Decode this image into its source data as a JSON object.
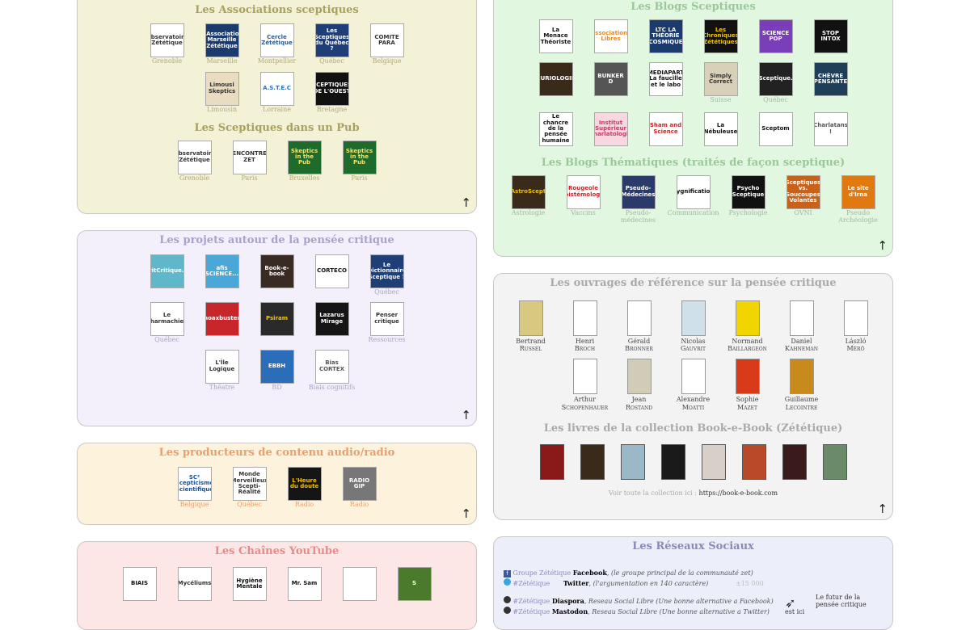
{
  "assoc": {
    "title": "Les Associations sceptiques",
    "items": [
      {
        "logo": "Observatoire Zététique",
        "caption": "Grenoble",
        "bg": "#ffffff",
        "fg": "#333"
      },
      {
        "logo": "L'Association Marseille Zététique",
        "caption": "Marseille",
        "bg": "#1b3b6f",
        "fg": "#fff"
      },
      {
        "logo": "Cercle Zététique",
        "caption": "Montpellier",
        "bg": "#ffffff",
        "fg": "#2a5a9a"
      },
      {
        "logo": "Les Sceptiques du Québec ?",
        "caption": "Québec",
        "bg": "#1f3e78",
        "fg": "#fff"
      },
      {
        "logo": "COMITE PARA",
        "caption": "Belgique",
        "bg": "#ffffff",
        "fg": "#333"
      },
      {
        "logo": "Limousi Skeptics",
        "caption": "Limousin",
        "bg": "#e9dcc0",
        "fg": "#333"
      },
      {
        "logo": "A.S.T.E.C",
        "caption": "Lorraine",
        "bg": "#ffffff",
        "fg": "#2a72b8"
      },
      {
        "logo": "SCEPTIQUES DE L'OUEST",
        "caption": "Bretagne",
        "bg": "#111111",
        "fg": "#fff"
      }
    ],
    "pub_title": "Les Sceptiques dans un Pub",
    "pub_items": [
      {
        "logo": "Observatoire Zététique",
        "caption": "Grenoble",
        "bg": "#ffffff",
        "fg": "#333"
      },
      {
        "logo": "RENCONTRES ZET",
        "caption": "Paris",
        "bg": "#ffffff",
        "fg": "#333"
      },
      {
        "logo": "Skeptics in the Pub",
        "caption": "Bruxelles",
        "bg": "#1f6b2c",
        "fg": "#f2e36b"
      },
      {
        "logo": "Skeptics in the Pub",
        "caption": "Paris",
        "bg": "#1f6b2c",
        "fg": "#f2e36b"
      }
    ]
  },
  "projets": {
    "title": "Les projets autour de la pensée critique",
    "items": [
      {
        "logo": "EspritCritique.info",
        "caption": "",
        "bg": "#5fb7c9",
        "fg": "#fff"
      },
      {
        "logo": "afis SCIENCE...",
        "caption": "",
        "bg": "#4aa8d8",
        "fg": "#fff"
      },
      {
        "logo": "Book-e-book",
        "caption": "",
        "bg": "#3a2a24",
        "fg": "#fff"
      },
      {
        "logo": "CORTECO",
        "caption": "",
        "bg": "#ffffff",
        "fg": "#111"
      },
      {
        "logo": "Le Dictionnaire Sceptique ?",
        "caption": "Québec",
        "bg": "#1f3e78",
        "fg": "#fff"
      },
      {
        "logo": "Le Pharmachien",
        "caption": "Québec",
        "bg": "#ffffff",
        "fg": "#333"
      },
      {
        "logo": "hoaxbuster",
        "caption": "",
        "bg": "#c8262a",
        "fg": "#fff"
      },
      {
        "logo": "Psiram",
        "caption": "",
        "bg": "#2a2a2a",
        "fg": "#f2c200"
      },
      {
        "logo": "Lazarus Mirage",
        "caption": "",
        "bg": "#151515",
        "fg": "#fff"
      },
      {
        "logo": "Penser critique",
        "caption": "Ressources",
        "bg": "#ffffff",
        "fg": "#333"
      },
      {
        "logo": "L'Île Logique",
        "caption": "Théatre",
        "bg": "#ffffff",
        "fg": "#333"
      },
      {
        "logo": "EBBH",
        "caption": "BD",
        "bg": "#2a6db8",
        "fg": "#fff"
      },
      {
        "logo": "Bias CORTEX",
        "caption": "Biais cognitifs",
        "bg": "#ffffff",
        "fg": "#555"
      }
    ]
  },
  "audio": {
    "title": "Les producteurs de contenu audio/radio",
    "items": [
      {
        "logo": "SC² Scepticisme Scientifique",
        "caption": "Belgique",
        "bg": "#ffffff",
        "fg": "#1b4d9a"
      },
      {
        "logo": "Monde Merveilleux Scepti-Réalité",
        "caption": "Québec",
        "bg": "#ffffff",
        "fg": "#333"
      },
      {
        "logo": "L'Heure du doute",
        "caption": "Radio",
        "bg": "#151515",
        "fg": "#f2c200"
      },
      {
        "logo": "RADIO GIP",
        "caption": "Radio",
        "bg": "#777777",
        "fg": "#fff"
      }
    ]
  },
  "youtube": {
    "title": "Les Chaînes YouTube",
    "items": [
      {
        "logo": "BIAIS",
        "bg": "#ffffff",
        "fg": "#111"
      },
      {
        "logo": "Mycéliums",
        "bg": "#ffffff",
        "fg": "#333"
      },
      {
        "logo": "Hygiène Mentale",
        "bg": "#ffffff",
        "fg": "#111"
      },
      {
        "logo": "Mr. Sam",
        "bg": "#ffffff",
        "fg": "#111"
      },
      {
        "logo": "",
        "bg": "#ffffff",
        "fg": "#111"
      },
      {
        "logo": "S",
        "bg": "#4a7a2a",
        "fg": "#fff"
      }
    ]
  },
  "blogs": {
    "title": "Les Blogs Sceptiques",
    "items": [
      {
        "logo": "La Menace Théoriste",
        "caption": "",
        "bg": "#ffffff",
        "fg": "#111"
      },
      {
        "logo": "Associations Libres",
        "caption": "",
        "bg": "#ffffff",
        "fg": "#e88a1a"
      },
      {
        "logo": "LTC LA THÉORIE COSMIQUE",
        "caption": "",
        "bg": "#1b3b6f",
        "fg": "#fff"
      },
      {
        "logo": "Les Chroniques Zététiques",
        "caption": "",
        "bg": "#111111",
        "fg": "#f2c200"
      },
      {
        "logo": "SCIENCE POP",
        "caption": "",
        "bg": "#7a3fb8",
        "fg": "#fff"
      },
      {
        "logo": "STOP INTOX",
        "caption": "",
        "bg": "#111111",
        "fg": "#fff"
      },
      {
        "logo": "CURIOLOGIE",
        "caption": "",
        "bg": "#3a2a1a",
        "fg": "#fff"
      },
      {
        "logo": "BUNKER D",
        "caption": "",
        "bg": "#555555",
        "fg": "#fff"
      },
      {
        "logo": "MEDIAPART La faucille et le labo",
        "caption": "",
        "bg": "#ffffff",
        "fg": "#111"
      },
      {
        "logo": "Simply Correct",
        "caption": "Suisse",
        "bg": "#d8d0b8",
        "fg": "#333"
      },
      {
        "logo": "LeSceptique.ca",
        "caption": "Québec",
        "bg": "#222222",
        "fg": "#fff"
      },
      {
        "logo": "CHÈVRE PENSANTE",
        "caption": "",
        "bg": "#1f3e58",
        "fg": "#fff"
      },
      {
        "logo": "Le chancre de la pensée humaine",
        "caption": "",
        "bg": "#ffffff",
        "fg": "#111"
      },
      {
        "logo": "Institut Supérieur Charlatologie",
        "caption": "",
        "bg": "#f7d8e0",
        "fg": "#c83a6a"
      },
      {
        "logo": "Sham and Science",
        "caption": "",
        "bg": "#ffffff",
        "fg": "#c8262a"
      },
      {
        "logo": "La Nébuleuse",
        "caption": "",
        "bg": "#ffffff",
        "fg": "#111"
      },
      {
        "logo": "Sceptom",
        "caption": "",
        "bg": "#ffffff",
        "fg": "#111"
      },
      {
        "logo": "Charlatans !",
        "caption": "",
        "bg": "#ffffff",
        "fg": "#555"
      }
    ],
    "them_title": "Les Blogs Thématiques (traités de façon sceptique)",
    "them_items": [
      {
        "logo": "AstroScept",
        "caption": "Astrologie",
        "bg": "#3a2a1a",
        "fg": "#f2c200"
      },
      {
        "logo": "Rougeole Epistémologie",
        "caption": "Vaccins",
        "bg": "#ffffff",
        "fg": "#c8262a"
      },
      {
        "logo": "Pseudo-Médecines",
        "caption": "Pseudo-médecines",
        "bg": "#2a3a6a",
        "fg": "#fff"
      },
      {
        "logo": "Cygnification",
        "caption": "Communication",
        "bg": "#ffffff",
        "fg": "#111"
      },
      {
        "logo": "Psycho Sceptique",
        "caption": "Psychologie",
        "bg": "#111111",
        "fg": "#fff"
      },
      {
        "logo": "Sceptiques vs. Soucoupes Volantes",
        "caption": "OVNI",
        "bg": "#c8621a",
        "fg": "#fff"
      },
      {
        "logo": "Le site d'Irna",
        "caption": "Pseudo Archéologie",
        "bg": "#e07a10",
        "fg": "#fff"
      }
    ]
  },
  "ouvrages": {
    "title": "Les ouvrages de référence sur la pensée critique",
    "row1": [
      {
        "first": "Bertrand",
        "last": "Russel",
        "cover": "#d8c880"
      },
      {
        "first": "Henri",
        "last": "Broch",
        "cover": "#ffffff"
      },
      {
        "first": "Gérald",
        "last": "Bronner",
        "cover": "#ffffff"
      },
      {
        "first": "Nicolas",
        "last": "Gauvrit",
        "cover": "#cfe0ea"
      },
      {
        "first": "Normand",
        "last": "Baillargeon",
        "cover": "#f2d400"
      },
      {
        "first": "Daniel",
        "last": "Kahneman",
        "cover": "#ffffff"
      },
      {
        "first": "László",
        "last": "Mérő",
        "cover": "#ffffff"
      }
    ],
    "row2": [
      {
        "first": "Arthur",
        "last": "Schopenhauer",
        "cover": "#ffffff"
      },
      {
        "first": "Jean",
        "last": "Rostand",
        "cover": "#d0ccb8"
      },
      {
        "first": "Alexandre",
        "last": "Moatti",
        "cover": "#ffffff"
      },
      {
        "first": "Sophie",
        "last": "Mazet",
        "cover": "#d83a1a"
      },
      {
        "first": "Guillaume",
        "last": "Lecointre",
        "cover": "#c88a1a"
      }
    ],
    "bebook_title": "Les livres de la collection Book-e-Book (Zététique)",
    "bebook_covers": [
      "#8a1a1a",
      "#3a2a1a",
      "#9ab8c8",
      "#1a1a1a",
      "#d8d0c8",
      "#b84a2a",
      "#3a1a1a",
      "#6a8a6a"
    ],
    "collection_prefix": "Voir toute la collection ici : ",
    "collection_link": "https://book-e-book.com"
  },
  "reseaux": {
    "title": "Les Réseaux Sociaux",
    "fb_tag": "Groupe Zététique",
    "fb_name": "Facebook",
    "fb_desc": ", (le groupe principal de la communauté zet)",
    "tw_tag": "#Zététique",
    "tw_name": "Twitter",
    "tw_desc": ", (l'argumentation en 140 caractère)",
    "tw_count": "±15 000",
    "dia_tag": "#Zététique",
    "dia_name": "Diaspora",
    "dia_desc": ", Reseau Social Libre (Une bonne alternative a Facebook)",
    "mas_tag": "#Zététique",
    "mas_name": "Mastodon",
    "mas_desc": ", Reseau Social Libre (Une bonne alternative a Twitter)",
    "est_ici": "est ici",
    "futur": "Le futur de la pensée critique"
  },
  "up_arrow": "↑"
}
